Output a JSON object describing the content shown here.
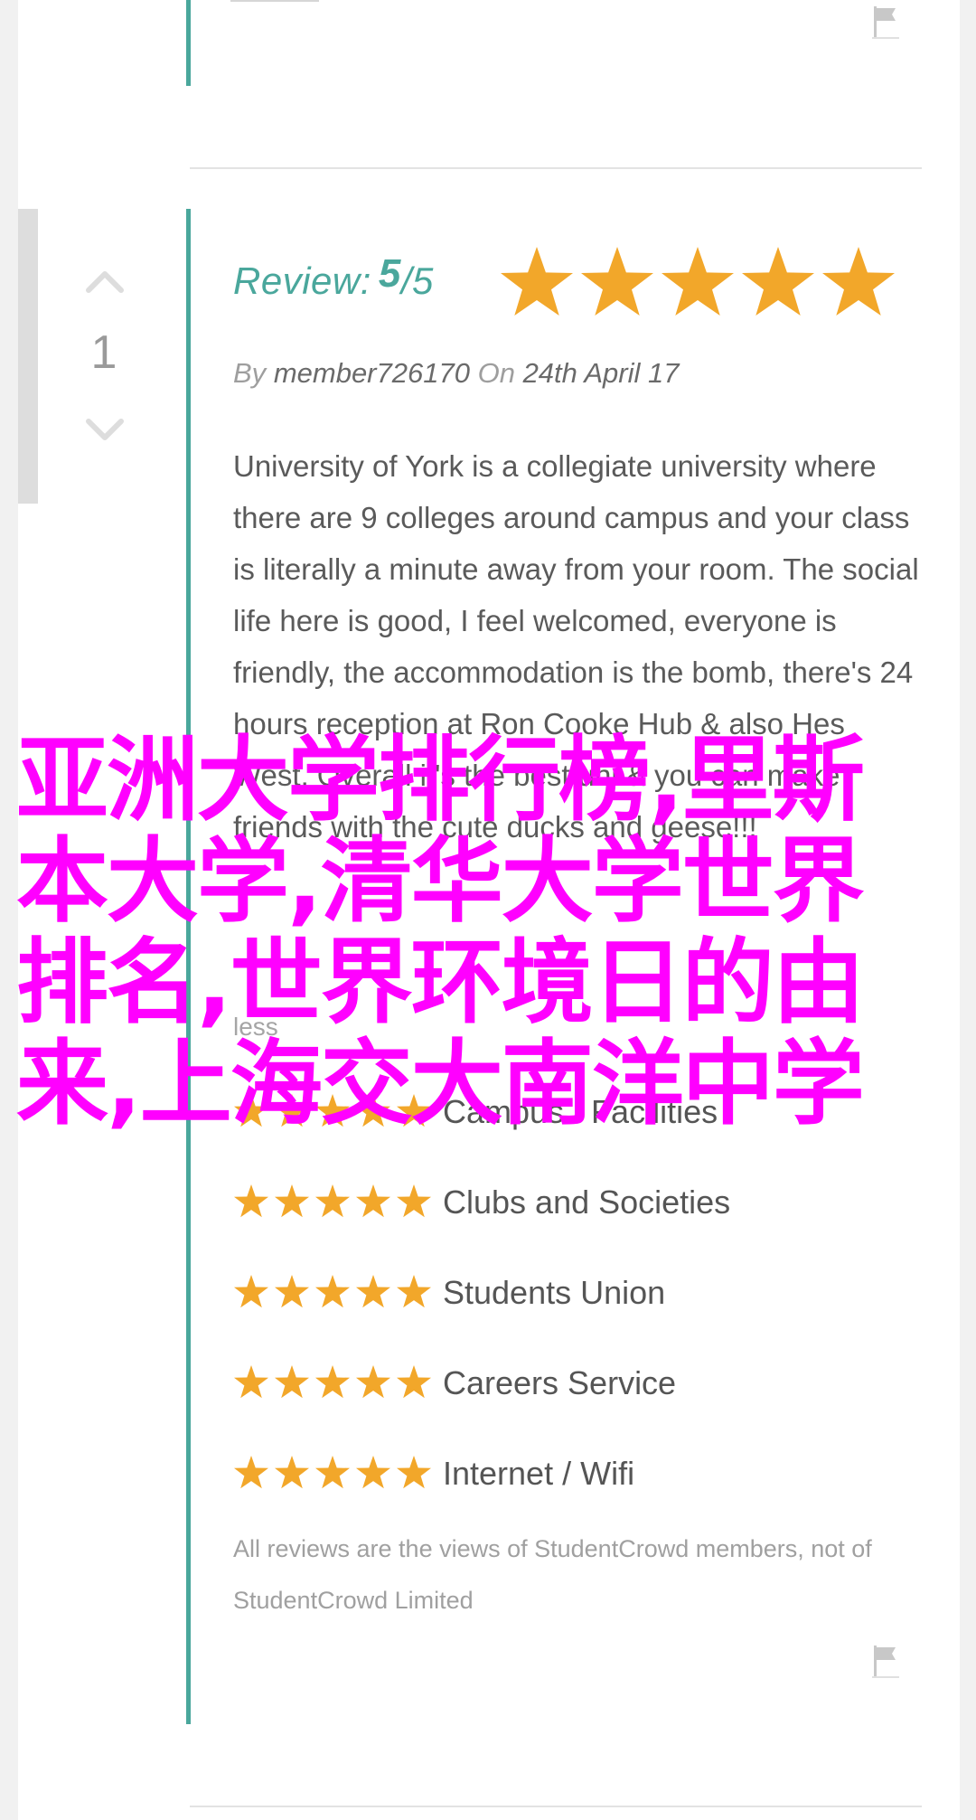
{
  "vote": {
    "count": "1"
  },
  "review": {
    "heading_label": "Review:",
    "score": "5",
    "score_total": "/5",
    "stars": 5,
    "by_prefix": "By",
    "author": "member726170",
    "on_prefix": "On",
    "date": "24th April 17",
    "body": "University of York is a collegiate university where there are 9 colleges around campus and your class is literally a minute away from your room. The social life here is good, I feel welcomed, everyone is friendly, the accommodation is the bomb, there's 24 hours reception at Ron Cooke Hub & also Hes West. Overall it's the best uni & you can make friends with the cute ducks and geese!!!",
    "less_link": "less",
    "ratings": [
      {
        "label": "Campus / Facilities",
        "stars": 5
      },
      {
        "label": "Clubs and Societies",
        "stars": 5
      },
      {
        "label": "Students Union",
        "stars": 5
      },
      {
        "label": "Careers Service",
        "stars": 5
      },
      {
        "label": "Internet / Wifi",
        "stars": 5
      }
    ],
    "disclaimer": "All reviews are the views of StudentCrowd members, not of StudentCrowd Limited"
  },
  "overlay_text": "亚洲大学排行榜,里斯本大学,清华大学世界排名,世界环境日的由来,上海交大南洋中学",
  "colors": {
    "accent": "#4aa79c",
    "star": "#f2a72a",
    "overlay": "#ff00ff"
  }
}
